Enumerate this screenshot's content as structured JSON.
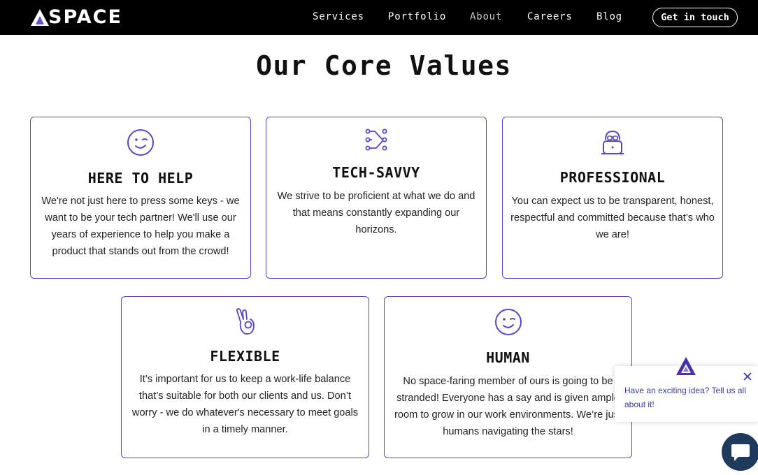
{
  "header": {
    "logo_text": "SPACE",
    "nav": [
      {
        "label": "Services"
      },
      {
        "label": "Portfolio"
      },
      {
        "label": "About"
      },
      {
        "label": "Careers"
      },
      {
        "label": "Blog"
      }
    ],
    "cta_label": "Get in touch"
  },
  "section": {
    "title": "Our Core Values"
  },
  "cards": [
    {
      "icon": "wink-smiley-icon",
      "title": "HERE TO HELP",
      "text": "We're not just here to press some keys - we want to be your tech partner! We'll use our years of experience to help you make a product that stands out from the crowd!"
    },
    {
      "icon": "connection-nodes-icon",
      "title": "TECH-SAVVY",
      "text": "We strive to be proficient at what we do and that means constantly expanding our horizons."
    },
    {
      "icon": "robot-with-glasses-icon",
      "title": "PROFESSIONAL",
      "text": "You can expect us to be transparent, honest, respectful and committed because that’s who we are!"
    },
    {
      "icon": "ok-hand-icon",
      "title": "FLEXIBLE",
      "text": "It’s important for us to keep a work-life balance that’s suitable for both our clients and us. Don’t worry - we do whatever's necessary to meet goals in a timely manner."
    },
    {
      "icon": "wink-smiley-icon",
      "title": "HUMAN",
      "text": "No space-faring member of ours is going to be stranded! Everyone has a say and is given ample room to grow in our work environments. We’re just humans navigating the stars!"
    }
  ],
  "chat": {
    "message": "Have an exciting idea? Tell us all about it!",
    "launcher_icon": "chat-bubble-icon",
    "close_icon": "close-icon"
  },
  "colors": {
    "accent": "#5b44c8",
    "header_bg": "#000000",
    "chat_text": "#3a3aa8",
    "launcher": "#1f3a5c"
  }
}
